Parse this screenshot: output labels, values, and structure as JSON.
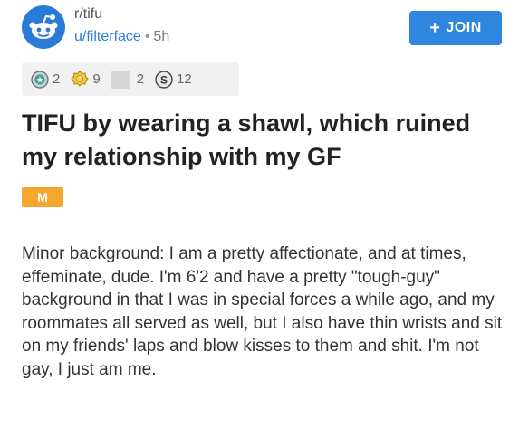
{
  "post": {
    "subreddit": "r/tifu",
    "username": "u/filterface",
    "separator": "•",
    "age": "5h",
    "join_label": "JOIN",
    "title": "TIFU by wearing a shawl, which ruined my relationship with my GF",
    "flair": "M",
    "body": "Minor background: I am a pretty affectionate, and at times, effeminate, dude. I'm 6'2 and have a pretty \"tough-guy\" background in that I was in special forces a while ago, and my roommates all served as well, but I also have thin wrists and sit on my friends' laps and blow kisses to them and shit. I'm not gay, I just am me."
  },
  "awards": [
    {
      "icon": "silver-coin-icon",
      "count": "2"
    },
    {
      "icon": "gold-award-icon",
      "count": "9"
    },
    {
      "icon": "placeholder-award-icon",
      "count": "2"
    },
    {
      "icon": "dollar-coin-icon",
      "count": "12"
    }
  ],
  "colors": {
    "join_button": "#2f86df",
    "username_link": "#2f7fd8",
    "flair_bg": "#f4a72c",
    "avatar_bg": "#2a7bd8"
  }
}
